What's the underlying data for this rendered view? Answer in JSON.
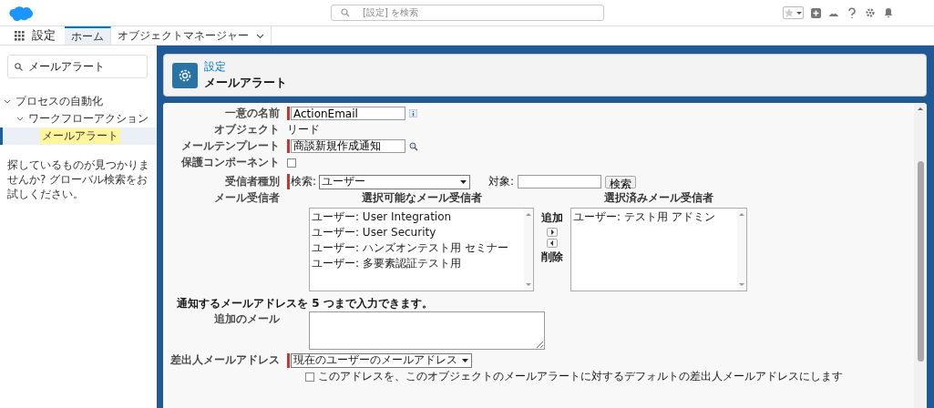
{
  "header": {
    "search_placeholder": "[設定] を検索"
  },
  "app": {
    "name": "設定",
    "tabs": [
      {
        "label": "ホーム",
        "selected": true
      },
      {
        "label": "オブジェクトマネージャー",
        "selected": false
      }
    ]
  },
  "sidebar": {
    "search_value": "メールアラート",
    "tree": [
      {
        "label": "プロセスの自動化",
        "expanded": true,
        "selected": false,
        "children": [
          {
            "label": "ワークフローアクション",
            "expanded": true,
            "selected": false,
            "children": [
              {
                "label": "メールアラート",
                "selected": true
              }
            ]
          }
        ]
      }
    ],
    "help": "探しているものが見つかりませんか? グローバル検索をお試しください。"
  },
  "page_header": {
    "breadcrumb": "設定",
    "title": "メールアラート"
  },
  "form": {
    "unique_name": {
      "label": "一意の名前",
      "value": "ActionEmail"
    },
    "object": {
      "label": "オブジェクト",
      "value": "リード"
    },
    "template": {
      "label": "メールテンプレート",
      "value": "商談新規作成通知"
    },
    "protected": {
      "label": "保護コンポーネント",
      "checked": false
    },
    "recipient_type": {
      "label": "受信者種別",
      "prefix": "検索:",
      "value": "ユーザー",
      "target_label": "対象:",
      "search_button": "検索"
    },
    "recipients": {
      "label": "メール受信者",
      "available_title": "選択可能なメール受信者",
      "available": [
        "ユーザー: User Integration",
        "ユーザー: User Security",
        "ユーザー: ハンズオンテスト用 セミナー",
        "ユーザー: 多要素認証テスト用"
      ],
      "add_label": "追加",
      "remove_label": "削除",
      "selected_title": "選択済みメール受信者",
      "selected": [
        "ユーザー: テスト用 アドミン"
      ]
    },
    "additional": {
      "note": "通知するメールアドレスを 5 つまで入力できます。",
      "label": "追加のメール"
    },
    "from": {
      "label": "差出人メールアドレス",
      "value": "現在のユーザーのメールアドレス"
    },
    "default_from": {
      "label": "このアドレスを、このオブジェクトのメールアラートに対するデフォルトの差出人メールアドレスにします",
      "checked": false
    }
  }
}
